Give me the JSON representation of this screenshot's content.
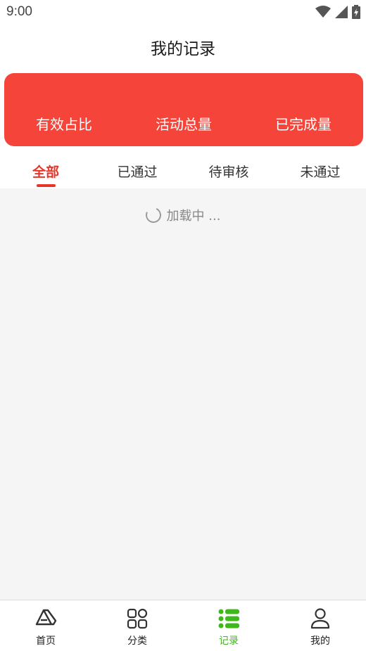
{
  "status_bar": {
    "time": "9:00"
  },
  "header": {
    "title": "我的记录"
  },
  "stats": {
    "items": [
      "有效占比",
      "活动总量",
      "已完成量"
    ]
  },
  "tabs": {
    "items": [
      "全部",
      "已通过",
      "待审核",
      "未通过"
    ],
    "active_index": 0
  },
  "loading": {
    "text": "加载中 ..."
  },
  "bottom_nav": {
    "items": [
      {
        "label": "首页",
        "icon": "home-icon"
      },
      {
        "label": "分类",
        "icon": "category-grid-icon"
      },
      {
        "label": "记录",
        "icon": "list-icon"
      },
      {
        "label": "我的",
        "icon": "user-icon"
      }
    ],
    "active_index": 2
  },
  "colors": {
    "accent_red": "#f5443a",
    "tab_active": "#e8352a",
    "nav_active": "#3fb81b"
  }
}
